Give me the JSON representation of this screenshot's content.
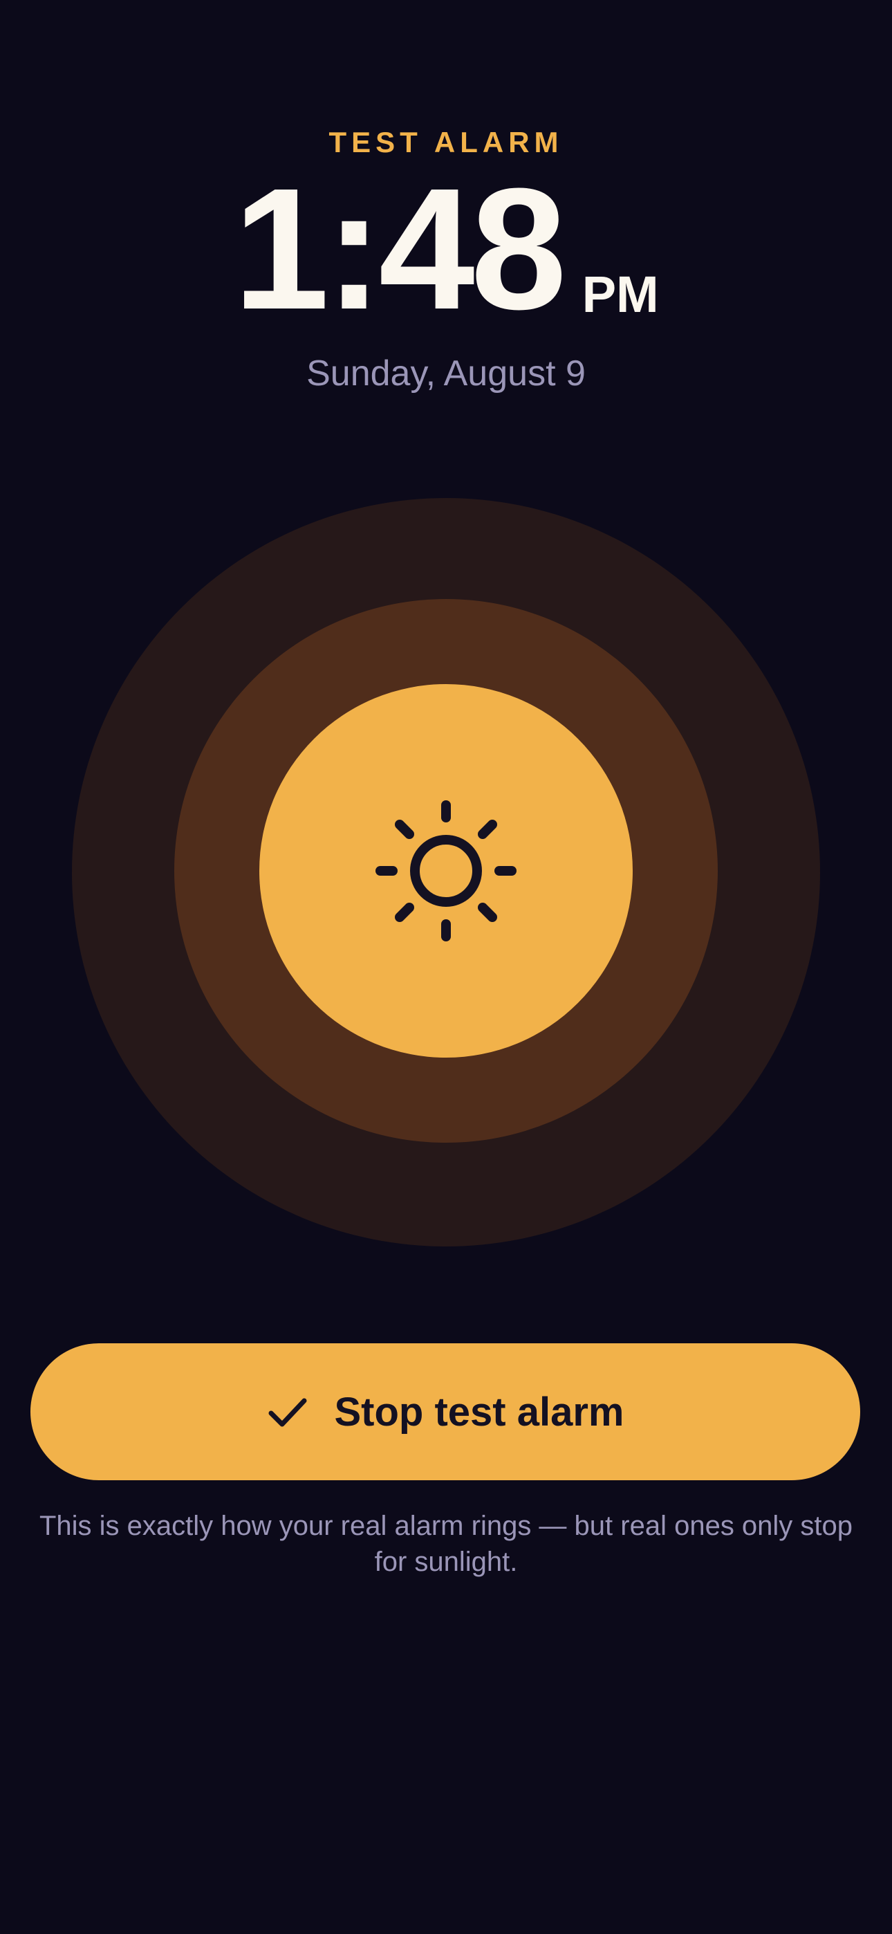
{
  "header": {
    "label": "TEST ALARM"
  },
  "clock": {
    "time": "1:48",
    "ampm": "PM",
    "date": "Sunday, August 9"
  },
  "visual": {
    "icon": "sun-icon",
    "colors": {
      "accent": "#f2b24a",
      "background": "#0c0a1a",
      "ring_middle": "#502d1b",
      "ring_outer": "#261819"
    }
  },
  "actions": {
    "stop_label": "Stop test alarm",
    "stop_icon": "check-icon"
  },
  "footer": {
    "note": "This is exactly how your real alarm rings — but real ones only stop for sunlight."
  }
}
